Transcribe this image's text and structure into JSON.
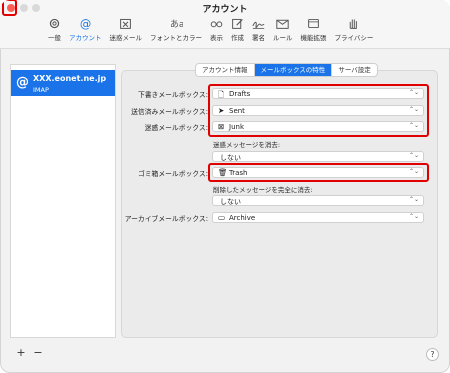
{
  "window": {
    "title": "アカウント"
  },
  "toolbar": {
    "items": [
      {
        "label": "一般",
        "icon": "gear-icon"
      },
      {
        "label": "アカウント",
        "icon": "at-icon",
        "active": true
      },
      {
        "label": "迷惑メール",
        "icon": "junk-icon"
      },
      {
        "label": "フォントとカラー",
        "icon": "font-icon"
      },
      {
        "label": "表示",
        "icon": "glasses-icon"
      },
      {
        "label": "作成",
        "icon": "compose-icon"
      },
      {
        "label": "署名",
        "icon": "signature-icon"
      },
      {
        "label": "ルール",
        "icon": "rules-icon"
      },
      {
        "label": "機能拡張",
        "icon": "extensions-icon"
      },
      {
        "label": "プライバシー",
        "icon": "privacy-hand-icon"
      }
    ]
  },
  "sidebar": {
    "account": {
      "name": "XXX.eonet.ne.jp",
      "type": "IMAP",
      "icon": "@"
    }
  },
  "tabs": [
    {
      "label": "アカウント情報"
    },
    {
      "label": "メールボックスの特性",
      "active": true
    },
    {
      "label": "サーバ設定"
    }
  ],
  "form": {
    "drafts_label": "下書きメールボックス:",
    "drafts_value": "Drafts",
    "sent_label": "送信済みメールボックス:",
    "sent_value": "Sent",
    "junk_label": "迷惑メールボックス:",
    "junk_value": "Junk",
    "erase_junk_label": "迷惑メッセージを消去:",
    "erase_junk_value": "しない",
    "trash_label": "ゴミ箱メールボックス:",
    "trash_value": "Trash",
    "erase_trash_label": "削除したメッセージを完全に消去:",
    "erase_trash_value": "しない",
    "archive_label": "アーカイブメールボックス:",
    "archive_value": "Archive"
  },
  "footer": {
    "add": "+",
    "remove": "−",
    "help": "?"
  },
  "colors": {
    "accent": "#1a73e8",
    "highlight": "#e00000"
  }
}
